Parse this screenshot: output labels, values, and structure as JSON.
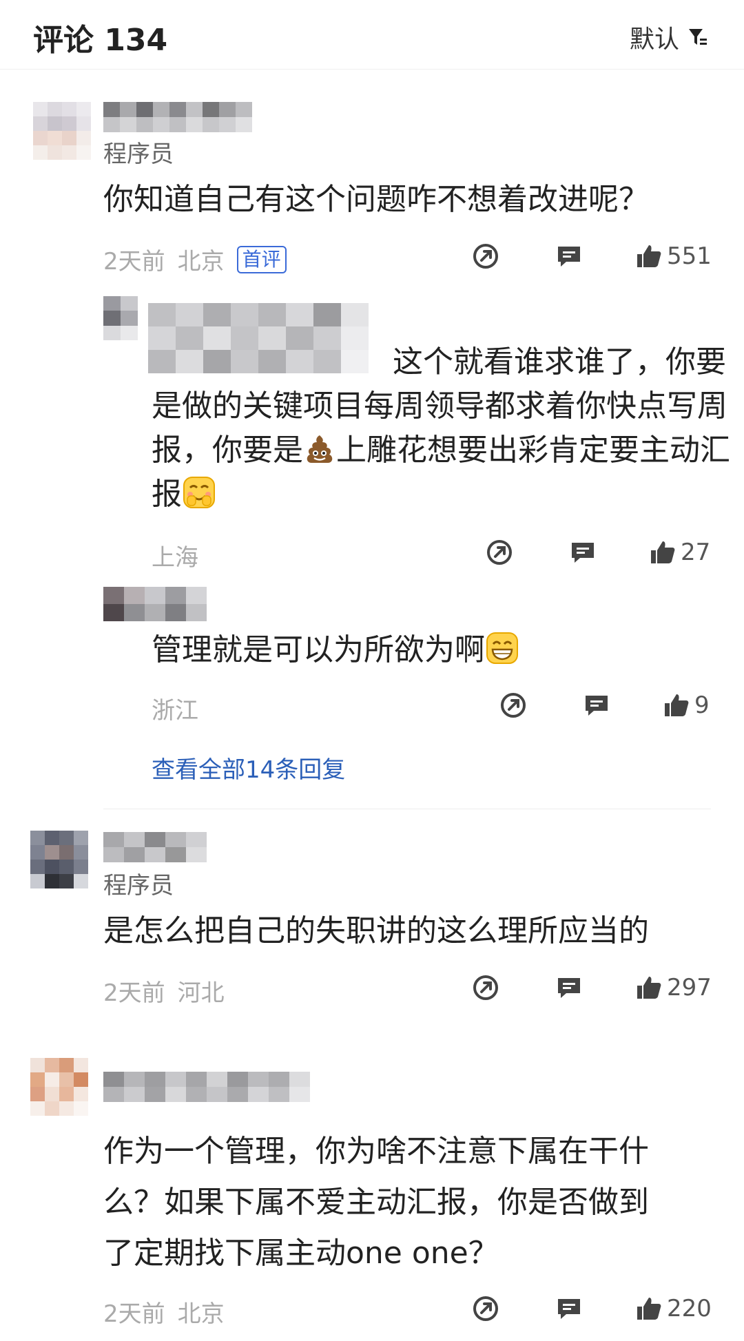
{
  "header": {
    "title": "评论 134",
    "sort_label": "默认"
  },
  "comments": [
    {
      "role": "程序员",
      "text": "你知道自己有这个问题咋不想着改进呢？",
      "time": "2天前",
      "location": "北京",
      "badge": "首评",
      "likes": "551",
      "replies": [
        {
          "text_a": "这个就看谁求谁了，你要",
          "text_b": "是做的关键项目每周领导都求着你快点写周",
          "text_c1": "报，你要是",
          "text_c2": "上雕花想要出彩肯定要主动汇",
          "text_d": "报",
          "location": "上海",
          "likes": "27"
        },
        {
          "text": "管理就是可以为所欲为啊",
          "location": "浙江",
          "likes": "9"
        }
      ],
      "view_all": "查看全部14条回复"
    },
    {
      "role": "程序员",
      "text": "是怎么把自己的失职讲的这么理所应当的",
      "time": "2天前",
      "location": "河北",
      "likes": "297"
    },
    {
      "text_lines": [
        "作为一个管理，你为啥不注意下属在干什",
        "么？如果下属不爱主动汇报，你是否做到",
        "了定期找下属主动one one？"
      ],
      "time": "2天前",
      "location": "北京",
      "likes": "220"
    }
  ],
  "icons": [
    "filter-icon",
    "share-icon",
    "reply-icon",
    "thumbs-up-icon",
    "poop-emoji-icon",
    "smile-emoji-icon",
    "grin-emoji-icon"
  ],
  "colors": {
    "link": "#2b5fb8",
    "badge": "#3a6ad8",
    "meta": "#aaaaaa"
  }
}
